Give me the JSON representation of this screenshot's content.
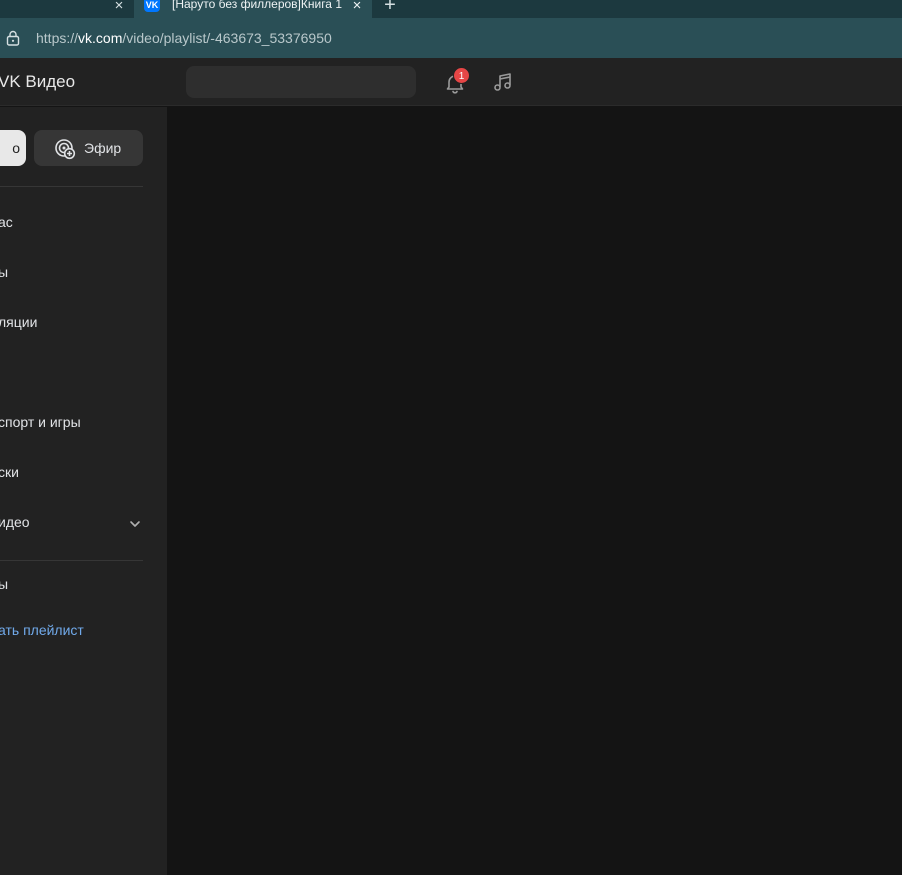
{
  "browser": {
    "tab_title": "[Наруто без филлеров]Книга 1",
    "favicon_label": "VK",
    "close_glyph": "×",
    "new_tab_glyph": "+",
    "url_prefix": "https://",
    "url_host": "vk.com",
    "url_path": "/video/playlist/-463673_53376950"
  },
  "header": {
    "logo_text": "VK Видео",
    "notification_count": "1"
  },
  "sidebar": {
    "partial_button_label": "о",
    "live_button_label": "Эфир",
    "items": [
      {
        "label": "ас"
      },
      {
        "label": "ы"
      },
      {
        "label": "ляции"
      },
      {
        "label": "спорт и игры"
      },
      {
        "label": "ски"
      },
      {
        "label": "идео"
      }
    ],
    "secondary_item": "ы",
    "create_playlist": "ать плейлист"
  },
  "colors": {
    "tabstrip": "#1c393f",
    "addressbar": "#2a4f56",
    "header_bg": "#222222",
    "main_bg": "#141414",
    "accent_link": "#71aaeb",
    "badge": "#e64646"
  }
}
